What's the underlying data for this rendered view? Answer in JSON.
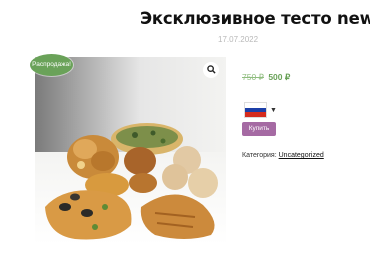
{
  "product": {
    "title": "Эксклюзивное тесто new",
    "date": "17.07.2022",
    "sale_badge": "Распродажа!",
    "old_price": "750 ₽",
    "new_price": "500 ₽",
    "buy_label": "Купить",
    "category_label": "Категория: ",
    "category_value": "Uncategorized"
  },
  "icons": {
    "zoom": "magnifier-icon",
    "flag": "russia-flag-icon",
    "caret": "caret-down-icon"
  },
  "colors": {
    "accent_green": "#6aa259",
    "buy_purple": "#a56aa3",
    "date_gray": "#b9b9b9"
  }
}
